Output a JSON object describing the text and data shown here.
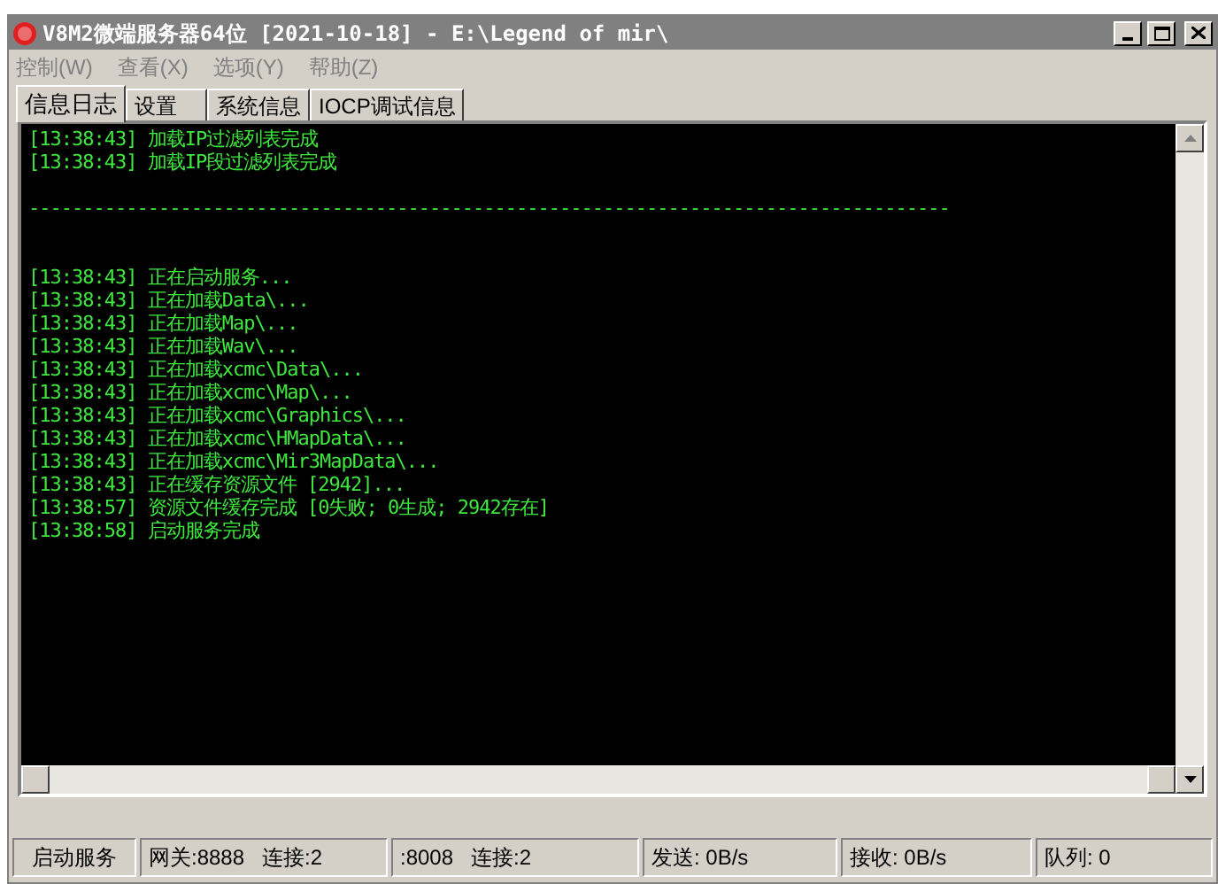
{
  "window": {
    "title": "V8M2微端服务器64位 [2021-10-18] - E:\\Legend of mir\\"
  },
  "menu": [
    "控制(W)",
    "查看(X)",
    "选项(Y)",
    "帮助(Z)"
  ],
  "tabs": [
    {
      "label": "信息日志",
      "selected": true
    },
    {
      "label": "设置",
      "selected": false
    },
    {
      "label": "系统信息",
      "selected": false
    },
    {
      "label": "IOCP调试信息",
      "selected": false
    }
  ],
  "log": [
    {
      "kind": "line",
      "text": "[13:38:43] 加载IP过滤列表完成"
    },
    {
      "kind": "line",
      "text": "[13:38:43] 加载IP段过滤列表完成"
    },
    {
      "kind": "separator",
      "text": "-------------------------------------------------------------------------------------"
    },
    {
      "kind": "line",
      "text": "[13:38:43] 正在启动服务..."
    },
    {
      "kind": "line",
      "text": "[13:38:43] 正在加载Data\\..."
    },
    {
      "kind": "line",
      "text": "[13:38:43] 正在加载Map\\..."
    },
    {
      "kind": "line",
      "text": "[13:38:43] 正在加载Wav\\..."
    },
    {
      "kind": "line",
      "text": "[13:38:43] 正在加载xcmc\\Data\\..."
    },
    {
      "kind": "line",
      "text": "[13:38:43] 正在加载xcmc\\Map\\..."
    },
    {
      "kind": "line",
      "text": "[13:38:43] 正在加载xcmc\\Graphics\\..."
    },
    {
      "kind": "line",
      "text": "[13:38:43] 正在加载xcmc\\HMapData\\..."
    },
    {
      "kind": "line",
      "text": "[13:38:43] 正在加载xcmc\\Mir3MapData\\..."
    },
    {
      "kind": "line",
      "text": "[13:38:43] 正在缓存资源文件 [2942]..."
    },
    {
      "kind": "line",
      "text": "[13:38:57] 资源文件缓存完成 [0失败; 0生成; 2942存在]"
    },
    {
      "kind": "line",
      "text": "[13:38:58] 启动服务完成"
    }
  ],
  "status_bar": [
    [
      "启动服务"
    ],
    [
      "网关:8888",
      "连接:2"
    ],
    [
      ":8008",
      "连接:2"
    ],
    [
      "发送: 0B/s"
    ],
    [
      "接收: 0B/s"
    ],
    [
      "队列: 0"
    ]
  ]
}
